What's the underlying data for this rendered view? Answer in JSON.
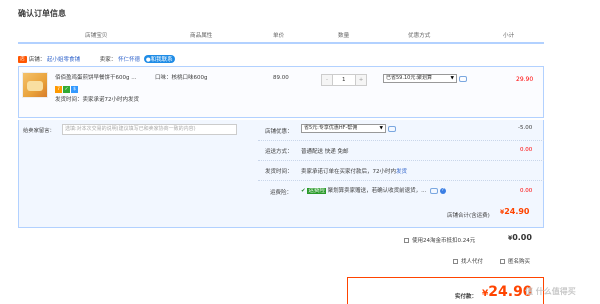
{
  "page": {
    "title": "确认订单信息"
  },
  "headers": [
    "店铺宝贝",
    "商品属性",
    "单价",
    "数量",
    "优惠方式",
    "小计"
  ],
  "shop": {
    "label": "店铺：",
    "name": "起小姐零食铺",
    "seller_label": "卖家：",
    "seller": "怀仁怀德",
    "contact": "和我联系"
  },
  "item": {
    "title": "佰佰盈鸡蛋煎饼早餐饼干600g ...",
    "attr": "口味：核桃口味600g",
    "shipping_note": "发货时间：卖家承诺72小时内发货",
    "price": "89.00",
    "qty": "1",
    "qty_minus": "-",
    "qty_plus": "+",
    "discount": "已省59.10元:聚划算",
    "subtotal": "29.90"
  },
  "memo": {
    "label": "给卖家留言：",
    "placeholder": "选填:对本次交易的说明(建议填写已和卖家协商一致的内容)"
  },
  "shop_discount": {
    "label": "店铺优惠：",
    "value": "省5元:专享优惠HF-帮佣",
    "amount": "-5.00"
  },
  "shipping": {
    "label": "运送方式：",
    "value": "普通配送 快递 免邮",
    "amount": "0.00"
  },
  "delivery": {
    "label": "发货时间：",
    "value": "卖家承诺订单在买家付款后，72小时内",
    "link": "发货"
  },
  "insurance": {
    "label": "运费险：",
    "badge": "运费险",
    "value": "聚划算卖家赠送，若确认收货前退货，...",
    "amount": "0.00"
  },
  "shop_total": {
    "label": "店铺合计(含运费)",
    "currency": "¥",
    "amount": "24.90"
  },
  "coins": {
    "label": "使用24淘金币抵扣0.24元",
    "currency": "¥",
    "amount": "0.00"
  },
  "options": {
    "anonymous_pay": "找人代付",
    "anonymous_buy": "匿名购买"
  },
  "pay": {
    "label": "实付款：",
    "currency": "¥",
    "amount": "24.90"
  },
  "watermark": "值 什么值得买",
  "colors": {
    "accent": "#ff4400",
    "price_red": "#ff0000",
    "border_blue": "#b2d1ff",
    "link_blue": "#3366cc"
  }
}
